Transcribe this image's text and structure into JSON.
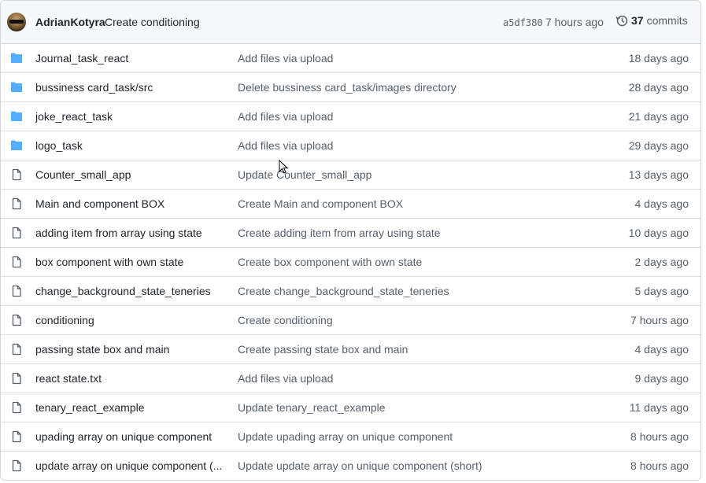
{
  "commit": {
    "author": "AdrianKotyra",
    "message": "Create conditioning",
    "sha": "a5df380",
    "time": "7 hours ago",
    "commits_count": "37",
    "commits_label": "commits"
  },
  "colors": {
    "folder": "#54aeff",
    "file": "#57606a",
    "border": "#d0d7de",
    "header_bg": "#f6f8fa"
  },
  "files": [
    {
      "type": "folder-icon",
      "name": "Journal_task_react",
      "message": "Add files via upload",
      "age": "18 days ago"
    },
    {
      "type": "folder-icon",
      "name": "bussiness card_task/src",
      "message": "Delete bussiness card_task/images directory",
      "age": "28 days ago"
    },
    {
      "type": "folder-icon",
      "name": "joke_react_task",
      "message": "Add files via upload",
      "age": "21 days ago"
    },
    {
      "type": "folder-icon",
      "name": "logo_task",
      "message": "Add files via upload",
      "age": "29 days ago"
    },
    {
      "type": "file-icon",
      "name": "Counter_small_app",
      "message": "Update Counter_small_app",
      "age": "13 days ago"
    },
    {
      "type": "file-icon",
      "name": "Main and component BOX",
      "message": "Create Main and component BOX",
      "age": "4 days ago"
    },
    {
      "type": "file-icon",
      "name": "adding item from array using state",
      "message": "Create adding item from array using state",
      "age": "10 days ago"
    },
    {
      "type": "file-icon",
      "name": "box component with own state",
      "message": "Create box component with own state",
      "age": "2 days ago"
    },
    {
      "type": "file-icon",
      "name": "change_background_state_teneries",
      "message": "Create change_background_state_teneries",
      "age": "5 days ago"
    },
    {
      "type": "file-icon",
      "name": "conditioning",
      "message": "Create conditioning",
      "age": "7 hours ago"
    },
    {
      "type": "file-icon",
      "name": "passing state box and main",
      "message": "Create passing state box and main",
      "age": "4 days ago"
    },
    {
      "type": "file-icon",
      "name": "react state.txt",
      "message": "Add files via upload",
      "age": "9 days ago"
    },
    {
      "type": "file-icon",
      "name": "tenary_react_example",
      "message": "Update tenary_react_example",
      "age": "11 days ago"
    },
    {
      "type": "file-icon",
      "name": "upading array on unique component",
      "message": "Update upading array on unique component",
      "age": "8 hours ago"
    },
    {
      "type": "file-icon",
      "name": "update array on unique component (...",
      "message": "Update update array on unique component (short)",
      "age": "8 hours ago"
    }
  ]
}
